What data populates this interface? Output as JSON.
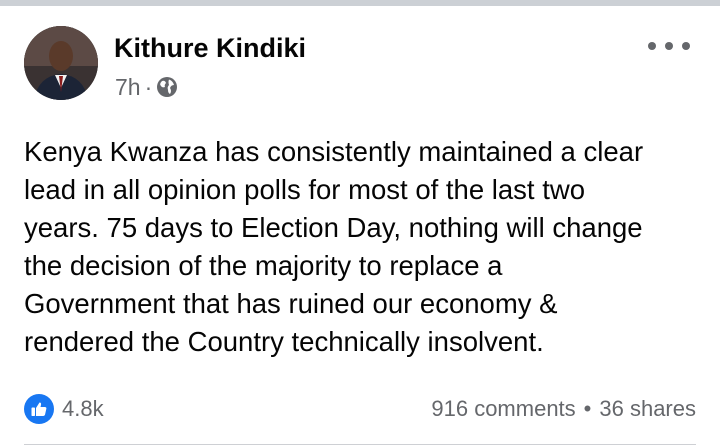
{
  "post": {
    "author_name": "Kithure Kindiki",
    "time_ago": "7h",
    "meta_separator": "·",
    "audience_icon": "globe-icon",
    "more_icon": "more-horizontal-icon",
    "body_text": "Kenya Kwanza has consistently maintained a clear\nlead in all opinion polls for most of the last two\nyears. 75 days to Election Day, nothing will change\nthe decision of the majority to replace a\nGovernment that has ruined our economy &\nrendered the Country technically insolvent.",
    "reactions": {
      "icon": "like-icon",
      "count": "4.8k"
    },
    "comments_label": "916 comments",
    "engagement_separator": "•",
    "shares_label": "36 shares"
  },
  "colors": {
    "like_blue": "#1877f2",
    "secondary_text": "#65676b",
    "primary_text": "#050505",
    "divider": "#ccd0d5"
  }
}
